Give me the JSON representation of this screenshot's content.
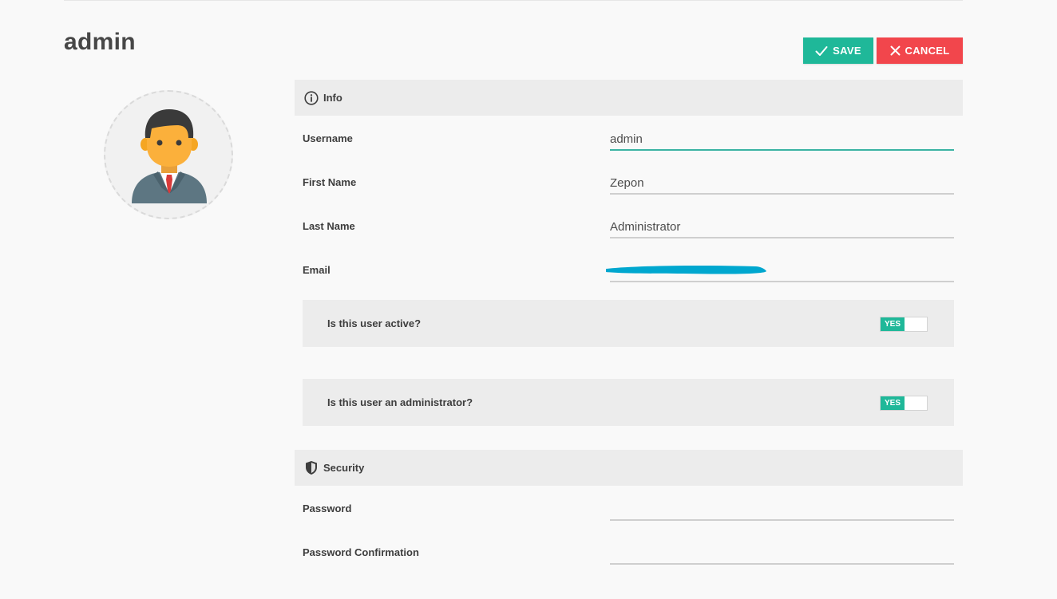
{
  "page": {
    "title": "admin"
  },
  "toolbar": {
    "save_label": "SAVE",
    "cancel_label": "CANCEL"
  },
  "colors": {
    "accent": "#1fb899",
    "danger": "#f2464c",
    "focus_underline": "#3bb3a3",
    "redaction": "#00a7cf"
  },
  "sections": {
    "info": {
      "title": "Info",
      "icon": "info-circle-icon"
    },
    "security": {
      "title": "Security",
      "icon": "shield-icon"
    }
  },
  "fields": {
    "username": {
      "label": "Username",
      "value": "admin"
    },
    "first_name": {
      "label": "First Name",
      "value": "Zepon"
    },
    "last_name": {
      "label": "Last Name",
      "value": "Administrator"
    },
    "email": {
      "label": "Email",
      "value": "",
      "redacted": true
    },
    "password": {
      "label": "Password",
      "value": ""
    },
    "password_confirmation": {
      "label": "Password Confirmation",
      "value": ""
    }
  },
  "toggles": {
    "active": {
      "label": "Is this user active?",
      "state": "YES"
    },
    "administrator": {
      "label": "Is this user an administrator?",
      "state": "YES"
    }
  },
  "avatar": {
    "icon": "user-avatar-icon"
  }
}
